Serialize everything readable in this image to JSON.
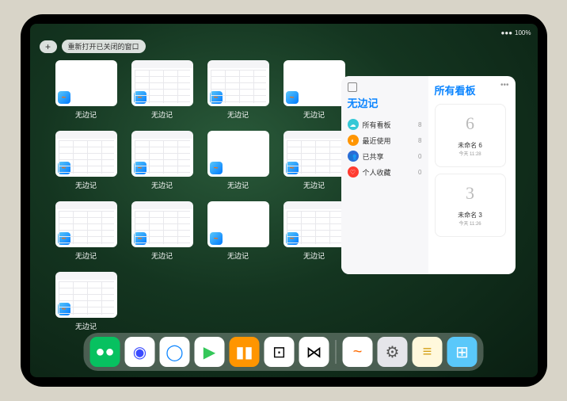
{
  "status": {
    "time": "",
    "battery": "100%",
    "wifi": "●●●"
  },
  "topControls": {
    "addLabel": "+",
    "reopenLabel": "重新打开已关闭的窗口"
  },
  "appSwitcher": {
    "appName": "无边记",
    "windows": [
      {
        "label": "无边记",
        "style": "blank"
      },
      {
        "label": "无边记",
        "style": "content"
      },
      {
        "label": "无边记",
        "style": "content"
      },
      {
        "label": "无边记",
        "style": "blank"
      },
      {
        "label": "无边记",
        "style": "content"
      },
      {
        "label": "无边记",
        "style": "content"
      },
      {
        "label": "无边记",
        "style": "blank"
      },
      {
        "label": "无边记",
        "style": "content"
      },
      {
        "label": "无边记",
        "style": "content"
      },
      {
        "label": "无边记",
        "style": "content"
      },
      {
        "label": "无边记",
        "style": "blank"
      },
      {
        "label": "无边记",
        "style": "content"
      },
      {
        "label": "无边记",
        "style": "content"
      }
    ]
  },
  "panel": {
    "leftTitle": "无边记",
    "rightTitle": "所有看板",
    "nav": [
      {
        "icon": "☁",
        "color": "#34c8d6",
        "label": "所有看板",
        "count": "8"
      },
      {
        "icon": "◐",
        "color": "#ff9500",
        "label": "最近使用",
        "count": "8"
      },
      {
        "icon": "👥",
        "color": "#2b6cd6",
        "label": "已共享",
        "count": "0"
      },
      {
        "icon": "♡",
        "color": "#ff3b30",
        "label": "个人收藏",
        "count": "0"
      }
    ],
    "boards": [
      {
        "sketch": "6",
        "name": "未命名 6",
        "date": "今天 11:28"
      },
      {
        "sketch": "3",
        "name": "未命名 3",
        "date": "今天 11:26"
      }
    ]
  },
  "dock": {
    "apps": [
      {
        "name": "wechat",
        "bg": "#07c160",
        "glyph": "●●"
      },
      {
        "name": "quark",
        "bg": "#ffffff",
        "glyph": "◉",
        "fg": "#3a4bff"
      },
      {
        "name": "qqbrowser",
        "bg": "#ffffff",
        "glyph": "◯",
        "fg": "#0a84ff"
      },
      {
        "name": "play",
        "bg": "#ffffff",
        "glyph": "▶",
        "fg": "#34c759"
      },
      {
        "name": "books",
        "bg": "#ff9500",
        "glyph": "▮▮",
        "fg": "#fff"
      },
      {
        "name": "dice",
        "bg": "#ffffff",
        "glyph": "⊡",
        "fg": "#000"
      },
      {
        "name": "connect",
        "bg": "#ffffff",
        "glyph": "⋈",
        "fg": "#000"
      }
    ],
    "recent": [
      {
        "name": "freeform",
        "bg": "#ffffff",
        "glyph": "~",
        "fg": "#ff6b00"
      },
      {
        "name": "settings",
        "bg": "#e5e5ea",
        "glyph": "⚙",
        "fg": "#555"
      },
      {
        "name": "notes",
        "bg": "#fff8dc",
        "glyph": "≡",
        "fg": "#d4a017"
      },
      {
        "name": "app-library",
        "bg": "#5ac8fa",
        "glyph": "⊞",
        "fg": "#fff"
      }
    ]
  }
}
